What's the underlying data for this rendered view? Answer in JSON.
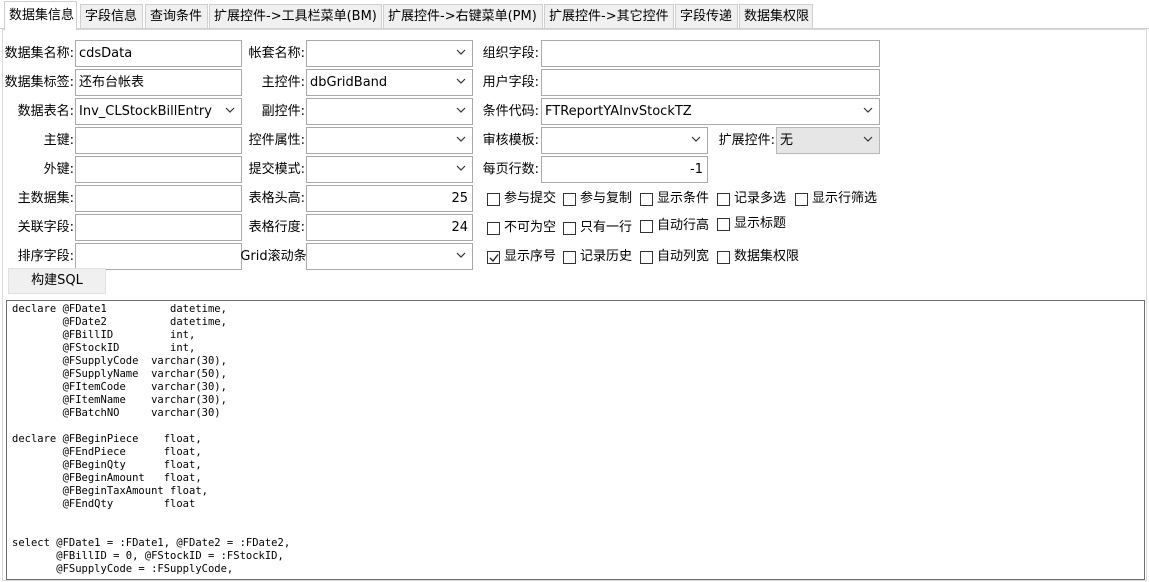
{
  "tabs": [
    {
      "label": "数据集信息",
      "active": true
    },
    {
      "label": "字段信息"
    },
    {
      "label": "查询条件"
    },
    {
      "label": "扩展控件->工具栏菜单(BM)"
    },
    {
      "label": "扩展控件->右键菜单(PM)"
    },
    {
      "label": "扩展控件->其它控件"
    },
    {
      "label": "字段传递"
    },
    {
      "label": "数据集权限"
    }
  ],
  "form": {
    "dataset_name_label": "数据集名称:",
    "dataset_name_value": "cdsData",
    "dataset_tag_label": "数据集标签:",
    "dataset_tag_value": "还布台帐表",
    "table_name_label": "数据表名:",
    "table_name_value": "Inv_CLStockBillEntry",
    "primary_key_label": "主键:",
    "primary_key_value": "",
    "foreign_key_label": "外键:",
    "foreign_key_value": "",
    "master_dataset_label": "主数据集:",
    "master_dataset_value": "",
    "link_field_label": "关联字段:",
    "link_field_value": "",
    "sort_field_label": "排序字段:",
    "sort_field_value": "",
    "account_name_label": "帐套名称:",
    "account_name_value": "",
    "main_control_label": "主控件:",
    "main_control_value": "dbGridBand",
    "sub_control_label": "副控件:",
    "sub_control_value": "",
    "control_props_label": "控件属性:",
    "control_props_value": "",
    "submit_mode_label": "提交模式:",
    "submit_mode_value": "",
    "grid_header_height_label": "表格头高:",
    "grid_header_height_value": "25",
    "grid_row_height_label": "表格行度:",
    "grid_row_height_value": "24",
    "grid_scrollbar_label": "Grid滚动条:",
    "grid_scrollbar_value": "",
    "org_field_label": "组织字段:",
    "org_field_value": "",
    "user_field_label": "用户字段:",
    "user_field_value": "",
    "condition_code_label": "条件代码:",
    "condition_code_value": "FTReportYAInvStockTZ",
    "audit_template_label": "审核模板:",
    "audit_template_value": "",
    "ext_control_label": "扩展控件:",
    "ext_control_value": "无",
    "rows_per_page_label": "每页行数:",
    "rows_per_page_value": "-1"
  },
  "checkboxes": [
    {
      "label": "参与提交",
      "checked": false
    },
    {
      "label": "参与复制",
      "checked": false
    },
    {
      "label": "显示条件",
      "checked": false
    },
    {
      "label": "记录多选",
      "checked": false
    },
    {
      "label": "显示行筛选",
      "checked": false
    },
    {
      "label": "不可为空",
      "checked": false
    },
    {
      "label": "只有一行",
      "checked": false
    },
    {
      "label": "自动行高",
      "checked": false
    },
    {
      "label": "显示标题",
      "checked": false
    },
    {
      "label": "显示序号",
      "checked": true
    },
    {
      "label": "记录历史",
      "checked": false
    },
    {
      "label": "自动列宽",
      "checked": false
    },
    {
      "label": "数据集权限",
      "checked": false
    }
  ],
  "build_sql_label": "构建SQL",
  "sql_text": "declare @FDate1          datetime,\n        @FDate2          datetime,\n        @FBillID         int,\n        @FStockID        int,\n        @FSupplyCode  varchar(30),\n        @FSupplyName  varchar(50),\n        @FItemCode    varchar(30),\n        @FItemName    varchar(30),\n        @FBatchNO     varchar(30)\n\ndeclare @FBeginPiece    float,\n        @FEndPiece      float,\n        @FBeginQty      float,\n        @FBeginAmount   float,\n        @FBeginTaxAmount float,\n        @FEndQty        float\n\n\nselect @FDate1 = :FDate1, @FDate2 = :FDate2,\n       @FBillID = 0, @FStockID = :FStockID,\n       @FSupplyCode = :FSupplyCode,"
}
